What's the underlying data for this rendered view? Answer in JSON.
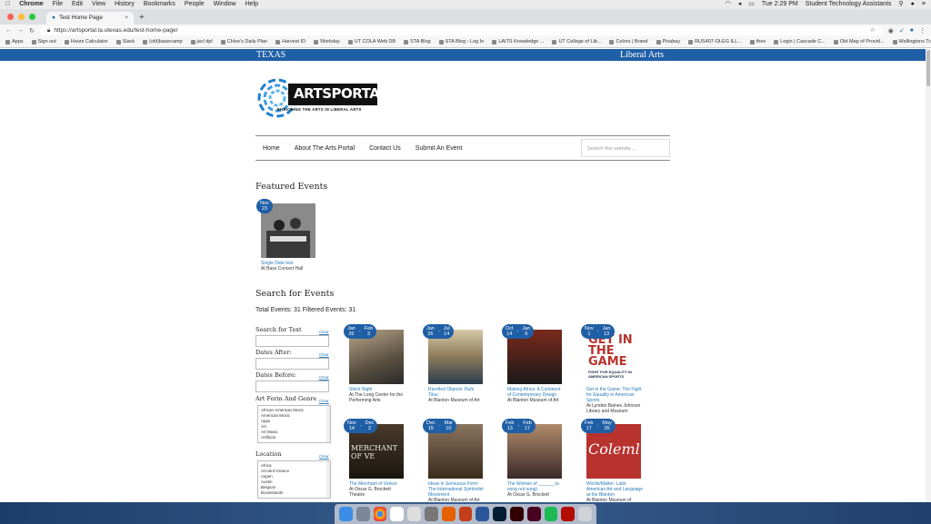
{
  "menubar": {
    "apple": "",
    "items": [
      "Chrome",
      "File",
      "Edit",
      "View",
      "History",
      "Bookmarks",
      "People",
      "Window",
      "Help"
    ],
    "time": "Tue 2:29 PM",
    "user": "Student Technology Assistants"
  },
  "browser": {
    "tab_title": "Test Home Page",
    "url": "https://artsportal.la.utexas.edu/test-home-page/",
    "bookmarks": [
      "Apps",
      "Sign out",
      "Hours Calculator",
      "Slack",
      "(old)basecamp",
      "jacl dpl",
      "Chloe's Daily Plan",
      "Harvest ID",
      "Workday",
      "UT COLA Web DB",
      "STA Blog",
      "STA Blog › Log In",
      "LAITS Knowledge ...",
      "UT College of Lib...",
      "Colors | Brand",
      "Pixabay",
      "RUS407-OLEG ILL...",
      "thes",
      "Login | Cascade C...",
      "Old Map of Provid...",
      "Wellingtons Travel..."
    ]
  },
  "ut_bar": {
    "left": "TEXAS",
    "right": "Liberal Arts"
  },
  "logo": {
    "title": "ARTSPORTAL",
    "tagline": "ENRICHING THE ARTS IN LIBERAL ARTS"
  },
  "nav": {
    "items": [
      "Home",
      "About The Arts Portal",
      "Contact Us",
      "Submit An Event"
    ],
    "search_placeholder": "Search this website ..."
  },
  "featured": {
    "heading": "Featured Events",
    "events": [
      {
        "month": "Nov",
        "day": "23",
        "title": "Single Date test",
        "location": "At Bass Concert Hall"
      }
    ]
  },
  "search": {
    "heading": "Search for Events",
    "totals": "Total Events: 31 Filtered Events: 31",
    "filters": {
      "text_label": "Search for Text",
      "after_label": "Dates After:",
      "before_label": "Dates Before:",
      "genre_label": "Art Form And Genre",
      "genres": [
        "African American Music",
        "American Music",
        "Apps",
        "Art",
        "Art Music",
        "Artifacts"
      ],
      "location_label": "Location",
      "locations": [
        "Africa",
        "Ancient Greece",
        "Aspen",
        "Austin",
        "Belgium",
        "Borderlands"
      ],
      "clear_label": "Clear"
    },
    "events": [
      {
        "m1": "Jan",
        "d1": "26",
        "m2": "Feb",
        "d2": "3",
        "title": "Silent Night",
        "location": "At The Long Center for the Performing Arts"
      },
      {
        "m1": "Jan",
        "d1": "26",
        "m2": "Jul",
        "d2": "14",
        "title": "Rarefied Objects: Ruhi Titus",
        "location": "At Blanton Museum of Art"
      },
      {
        "m1": "Oct",
        "d1": "14",
        "m2": "Jan",
        "d2": "6",
        "title": "Making Africa: A Continent of Contemporary Design",
        "location": "At Blanton Museum of Art"
      },
      {
        "m1": "Nov",
        "d1": "1",
        "m2": "Jan",
        "d2": "13",
        "title": "Get in the Game: The Fight for Equality in American Sports",
        "location": "At Lyndon Baines Johnson Library and Museum"
      },
      {
        "m1": "Nov",
        "d1": "14",
        "m2": "Dec",
        "d2": "2",
        "title": "The Merchant of Venice",
        "location": "At Oscar G. Brockett Theatre"
      },
      {
        "m1": "Dec",
        "d1": "15",
        "m2": "Mar",
        "d2": "10",
        "title": "Ideas in Sensuous Form: The International Symbolist Movement",
        "location": "At Blanton Museum of Art"
      },
      {
        "m1": "Feb",
        "d1": "13",
        "m2": "Feb",
        "d2": "17",
        "title": "The Women of ______ (a song not sung)",
        "location": "At Oscar G. Brockett"
      },
      {
        "m1": "Feb",
        "d1": "17",
        "m2": "May",
        "d2": "26",
        "title": "Words/Matter: Latin American Art and Language at the Blanton",
        "location": "At Blanton Museum of"
      }
    ],
    "thumb_text": {
      "e3": "GET IN THE GAME",
      "e3_sub": "FIGHT FOR EQUALITY IN AMERICAN SPORTS",
      "e4": "MERCHANT OF VE",
      "e7": "Coleml"
    }
  },
  "colors": {
    "ut_blue": "#1f5fa6",
    "link": "#2a7ab8"
  }
}
